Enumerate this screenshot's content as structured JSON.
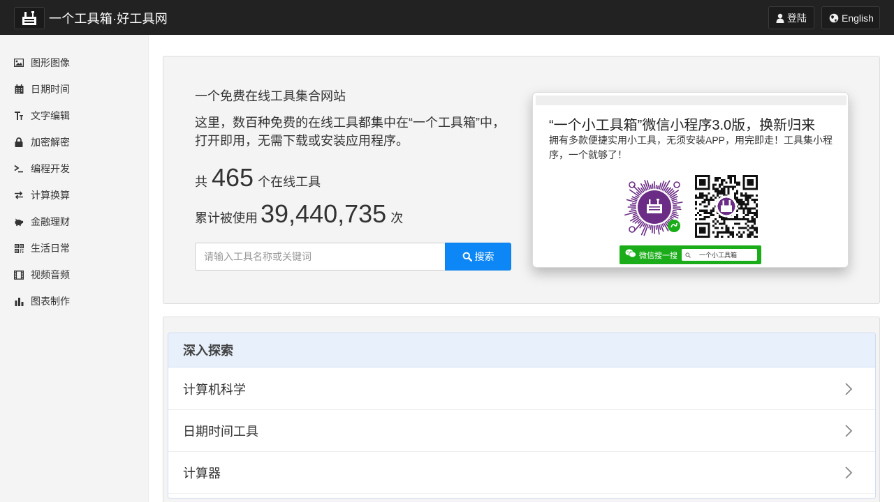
{
  "header": {
    "title": "一个工具箱·好工具网",
    "login_label": "登陆",
    "english_label": "English"
  },
  "sidebar": {
    "items": [
      {
        "label": "图形图像",
        "icon": "image-icon"
      },
      {
        "label": "日期时间",
        "icon": "calendar-icon"
      },
      {
        "label": "文字编辑",
        "icon": "text-icon"
      },
      {
        "label": "加密解密",
        "icon": "lock-icon"
      },
      {
        "label": "编程开发",
        "icon": "terminal-icon"
      },
      {
        "label": "计算换算",
        "icon": "exchange-icon"
      },
      {
        "label": "金融理财",
        "icon": "piggy-bank-icon"
      },
      {
        "label": "生活日常",
        "icon": "qrcode-icon"
      },
      {
        "label": "视频音频",
        "icon": "film-icon"
      },
      {
        "label": "图表制作",
        "icon": "bar-chart-icon"
      }
    ]
  },
  "hero": {
    "tagline": "一个免费在线工具集合网站",
    "description": "这里，数百种免费的在线工具都集中在“一个工具箱”中，打开即用，无需下载或安装应用程序。",
    "count_prefix": "共",
    "tool_count": "465",
    "count_suffix": "个在线工具",
    "usage_prefix": "累计被使用",
    "usage_count": "39,440,735",
    "usage_suffix": "次",
    "search_placeholder": "请输入工具名称或关键词",
    "search_button": "搜索"
  },
  "promo": {
    "title": "“一个小工具箱”微信小程序3.0版，换新归来",
    "description": "拥有多款便捷实用小工具，无须安装APP，用完即走！工具集小程序，一个就够了！",
    "bar_label": "微信搜一搜",
    "bar_search_text": "一个小工具箱"
  },
  "explore": {
    "heading": "深入探索",
    "items": [
      "计算机科学",
      "日期时间工具",
      "计算器"
    ]
  },
  "colors": {
    "navbar": "#222222",
    "accent": "#0d87f5",
    "wechat_green": "#1aad19",
    "brand_purple": "#6b2c86"
  }
}
